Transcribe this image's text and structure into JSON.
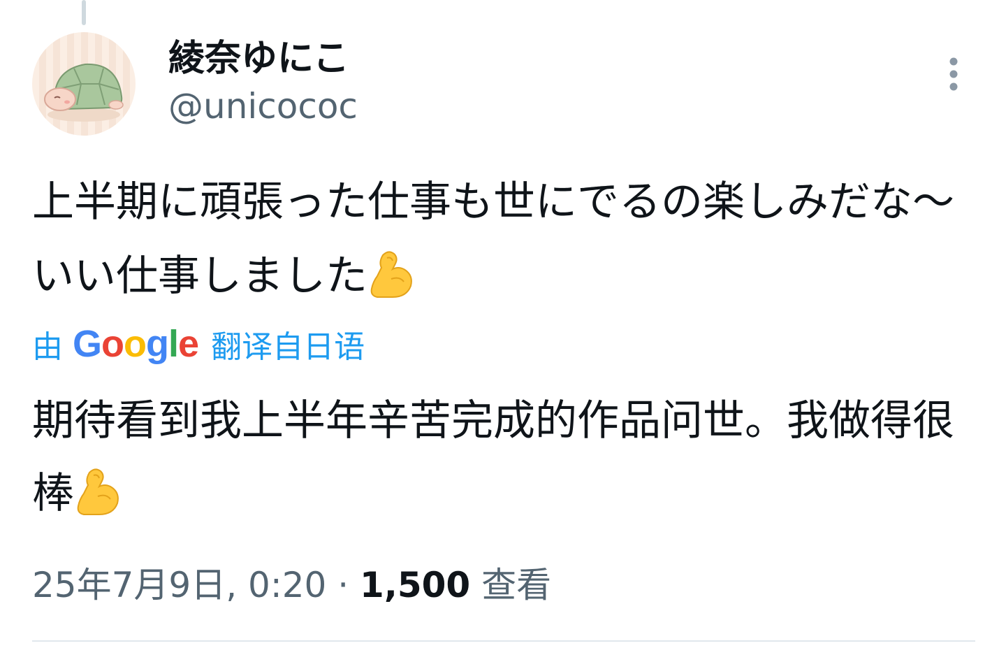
{
  "author": {
    "display_name": "綾奈ゆにこ",
    "handle": "@unicococ"
  },
  "tweet": {
    "text": "上半期に頑張った仕事も世にでるの楽しみだな〜いい仕事しました",
    "emoji": "flexed-biceps"
  },
  "translation": {
    "prefix": "由",
    "provider": "Google",
    "label": "翻译自日语",
    "text": "期待看到我上半年辛苦完成的作品问世。我做得很棒",
    "emoji": "flexed-biceps"
  },
  "meta": {
    "timestamp": "25年7月9日, 0:20",
    "separator": "·",
    "views_count": "1,500",
    "views_label": "查看"
  },
  "colors": {
    "accent": "#1d9bf0",
    "secondary_text": "#536471",
    "primary_text": "#0f1419"
  }
}
